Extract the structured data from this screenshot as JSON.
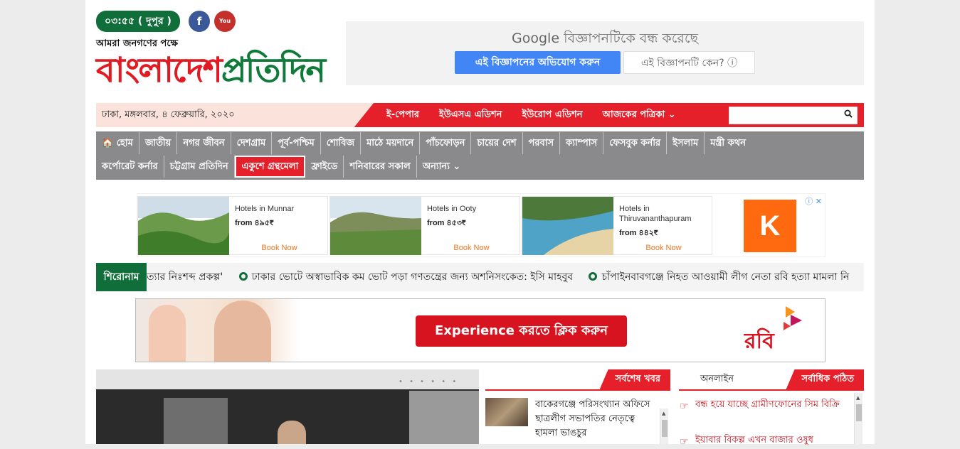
{
  "header": {
    "time": "০৩:৫৫ ( দুপুর )",
    "social": {
      "facebook_icon": "f",
      "youtube_icon": "You Tube"
    },
    "tagline": "আমরা জনগণের পক্ষে",
    "logo": {
      "part1": "বাংলাদেশ",
      "part2": "প্রতিদিন"
    }
  },
  "top_ad": {
    "google_text": "Google",
    "headline": "বিজ্ঞাপনটিকে বন্ধ করেছে",
    "report_button": "এই বিজ্ঞাপনের অভিযোগ করুন",
    "why_button": "এই বিজ্ঞাপনটি কেন?",
    "info_icon": "ⓘ"
  },
  "date_bar": {
    "date": "ঢাকা, মঙ্গলবার, ৪ ফেব্রুয়ারি, ২০২০",
    "links": [
      "ই-পেপার",
      "ইউএসএ এডিশন",
      "ইউরোপ এডিশন",
      "আজকের পত্রিকা ⌄"
    ],
    "search_placeholder": "",
    "search_icon": "search-icon"
  },
  "nav": {
    "row1": [
      "🏠 হোম",
      "জাতীয়",
      "নগর জীবন",
      "দেশগ্রাম",
      "পূর্ব-পশ্চিম",
      "শোবিজ",
      "মাঠে ময়দানে",
      "পাঁচফোড়ন",
      "চায়ের দেশ",
      "পরবাস",
      "ক্যাম্পাস",
      "ফেসবুক কর্নার",
      "ইসলাম",
      "মন্ত্রী কথন"
    ],
    "row2": [
      "কর্পোরেট কর্নার",
      "চট্টগ্রাম প্রতিদিন",
      "একুশে গ্রন্থমেলা",
      "ফ্রাইডে",
      "শনিবারের সকাল",
      "অন্যান্য ⌄"
    ]
  },
  "hotel_ad": {
    "hotels": [
      {
        "name": "Hotels in Munnar",
        "price": "from ৪৯৫₹",
        "cta": "Book Now"
      },
      {
        "name": "Hotels in Ooty",
        "price": "from ৪৫৩₹",
        "cta": "Book Now"
      },
      {
        "name": "Hotels in Thiruvananthapuram",
        "price": "from ৪৪২₹",
        "cta": "Book Now"
      }
    ],
    "brand_letter": "K",
    "adchoices": "ⓘ ✕"
  },
  "ticker": {
    "label": "শিরোনাম",
    "items": [
      "ত্যার নিঃশব্দ প্রকল্প'",
      "ঢাকার ভোটে অস্বাভাবিক কম ভোট পড়া গণতন্ত্রের জন্য অশনিসংকেত: ইসি মাহবুব",
      "চাঁপাইনবাবগঞ্জে নিহত আওয়ামী লীগ নেতা রবি হত্যা মামলা নি"
    ]
  },
  "banner": {
    "cta": "Experience করতে ক্লিক করুন",
    "brand": "রবি"
  },
  "sections": {
    "latest_tab": "সর্বশেষ খবর",
    "online_tab": "অনলাইন",
    "popular_tab": "সর্বাধিক পঠিত"
  },
  "latest_news": [
    {
      "title": "বাকেরগঞ্জে পরিসংখ্যান অফিসে ছাত্রলীগ সভাপতির নেতৃত্বে হামলা ভাঙচুর"
    }
  ],
  "popular": [
    {
      "title": "বন্ধ হয়ে যাচ্ছে গ্রামীণফোনের সিম বিক্রি"
    },
    {
      "title": "ইয়াবার বিকল্প এখন বাজার ওষুধ"
    }
  ],
  "colors": {
    "brand_red": "#e5202b",
    "brand_green": "#0f6e3a",
    "nav_gray": "#8a8a8c",
    "google_blue": "#4285f4"
  }
}
